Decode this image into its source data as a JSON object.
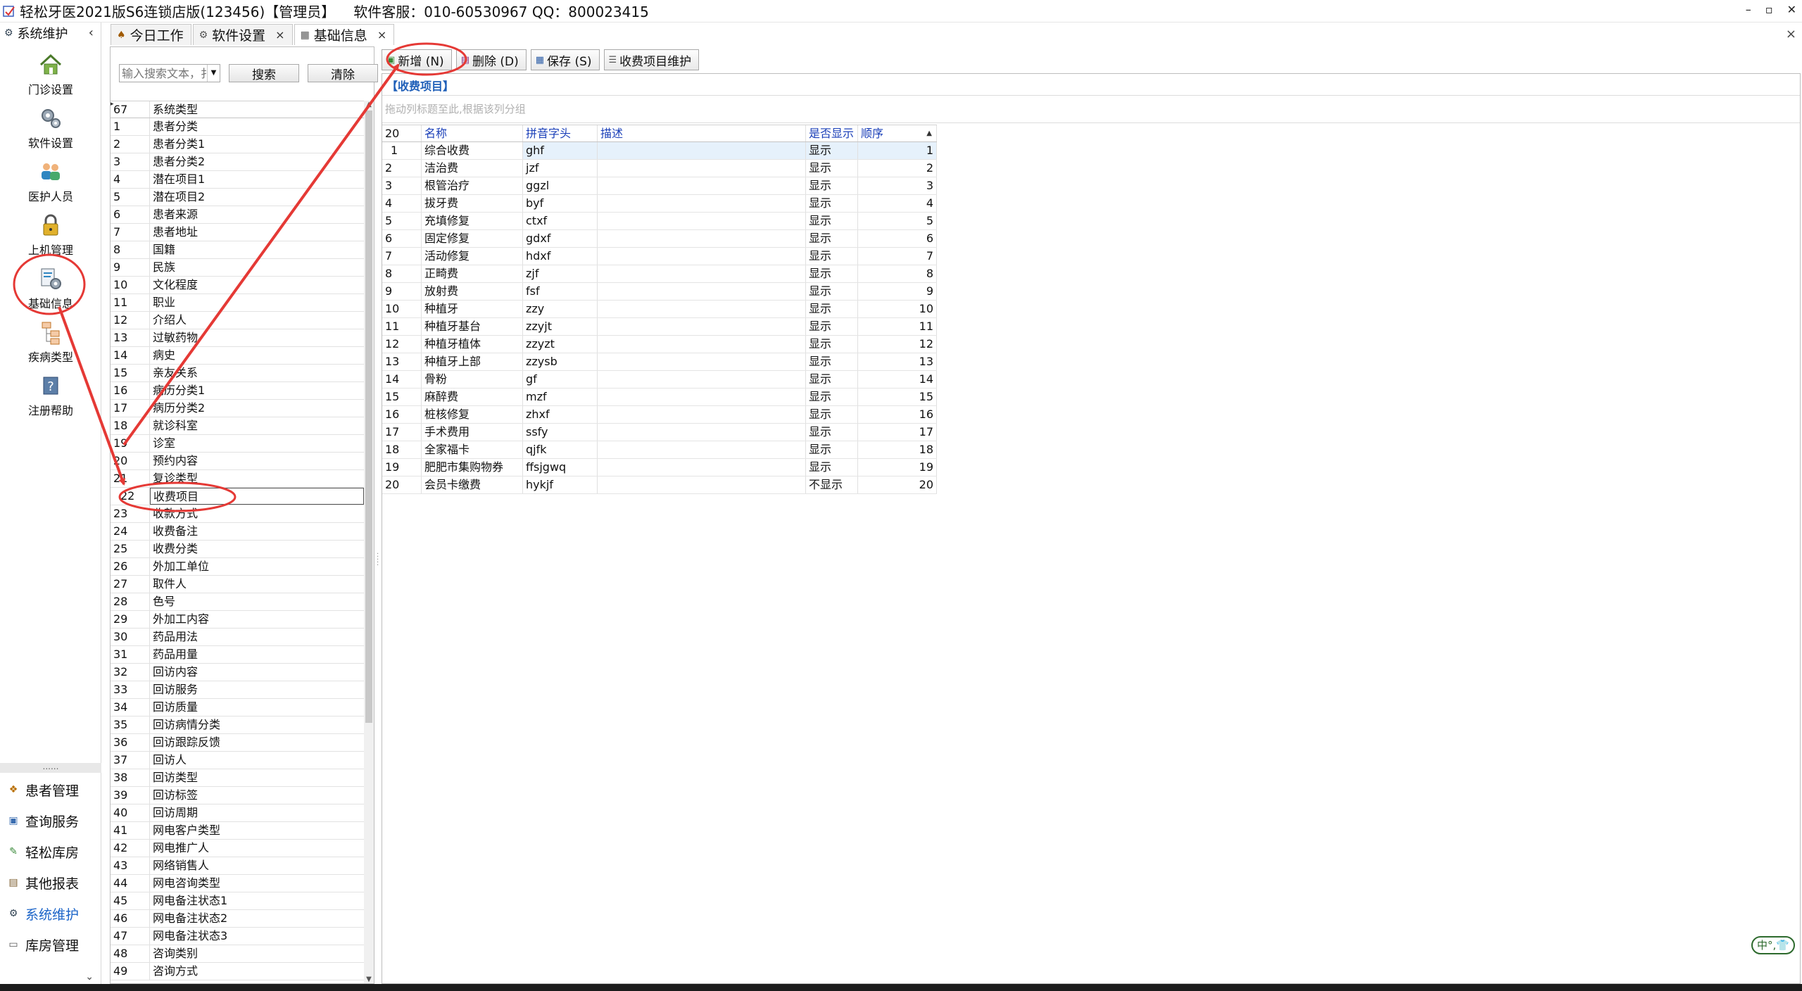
{
  "window": {
    "title": "轻松牙医2021版S6连锁店版(123456)【管理员】",
    "support": "软件客服：010-60530967 QQ：800023415",
    "buttons": [
      "–",
      "▫",
      "✕"
    ]
  },
  "sidebar": {
    "header": "系统维护",
    "collapse": "‹",
    "items": [
      {
        "label": "门诊设置",
        "icon": "house-icon"
      },
      {
        "label": "软件设置",
        "icon": "gears-icon"
      },
      {
        "label": "医护人员",
        "icon": "staff-icon"
      },
      {
        "label": "上机管理",
        "icon": "lock-icon"
      },
      {
        "label": "基础信息",
        "icon": "info-gear-icon"
      },
      {
        "label": "疾病类型",
        "icon": "tree-icon"
      },
      {
        "label": "注册帮助",
        "icon": "help-icon"
      }
    ],
    "dots": "......",
    "nav": [
      {
        "label": "患者管理"
      },
      {
        "label": "查询服务"
      },
      {
        "label": "轻松库房"
      },
      {
        "label": "其他报表"
      },
      {
        "label": "系统维护"
      },
      {
        "label": "库房管理"
      }
    ],
    "more": "⌄"
  },
  "tabs": [
    {
      "label": "今日工作",
      "closable": false
    },
    {
      "label": "软件设置",
      "closable": true
    },
    {
      "label": "基础信息",
      "closable": true
    }
  ],
  "tab_close_all": "×",
  "left_panel": {
    "search_placeholder": "输入搜索文本，扌",
    "search_button": "搜索",
    "clear_button": "清除",
    "count": "67",
    "column": "系统类型",
    "rows": [
      [
        "1",
        "患者分类"
      ],
      [
        "2",
        "患者分类1"
      ],
      [
        "3",
        "患者分类2"
      ],
      [
        "4",
        "潜在项目1"
      ],
      [
        "5",
        "潜在项目2"
      ],
      [
        "6",
        "患者来源"
      ],
      [
        "7",
        "患者地址"
      ],
      [
        "8",
        "国籍"
      ],
      [
        "9",
        "民族"
      ],
      [
        "10",
        "文化程度"
      ],
      [
        "11",
        "职业"
      ],
      [
        "12",
        "介绍人"
      ],
      [
        "13",
        "过敏药物"
      ],
      [
        "14",
        "病史"
      ],
      [
        "15",
        "亲友关系"
      ],
      [
        "16",
        "病历分类1"
      ],
      [
        "17",
        "病历分类2"
      ],
      [
        "18",
        "就诊科室"
      ],
      [
        "19",
        "诊室"
      ],
      [
        "20",
        "预约内容"
      ],
      [
        "21",
        "复诊类型"
      ],
      [
        "22",
        "收费项目"
      ],
      [
        "23",
        "收款方式"
      ],
      [
        "24",
        "收费备注"
      ],
      [
        "25",
        "收费分类"
      ],
      [
        "26",
        "外加工单位"
      ],
      [
        "27",
        "取件人"
      ],
      [
        "28",
        "色号"
      ],
      [
        "29",
        "外加工内容"
      ],
      [
        "30",
        "药品用法"
      ],
      [
        "31",
        "药品用量"
      ],
      [
        "32",
        "回访内容"
      ],
      [
        "33",
        "回访服务"
      ],
      [
        "34",
        "回访质量"
      ],
      [
        "35",
        "回访病情分类"
      ],
      [
        "36",
        "回访跟踪反馈"
      ],
      [
        "37",
        "回访人"
      ],
      [
        "38",
        "回访类型"
      ],
      [
        "39",
        "回访标签"
      ],
      [
        "40",
        "回访周期"
      ],
      [
        "41",
        "网电客户类型"
      ],
      [
        "42",
        "网电推广人"
      ],
      [
        "43",
        "网络销售人"
      ],
      [
        "44",
        "网电咨询类型"
      ],
      [
        "45",
        "网电备注状态1"
      ],
      [
        "46",
        "网电备注状态2"
      ],
      [
        "47",
        "网电备注状态3"
      ],
      [
        "48",
        "咨询类别"
      ],
      [
        "49",
        "咨询方式"
      ]
    ],
    "selected_index": 21
  },
  "toolbar": [
    {
      "label": "新增 (N)",
      "icon": "add-icon"
    },
    {
      "label": "删除 (D)",
      "icon": "delete-icon"
    },
    {
      "label": "保存 (S)",
      "icon": "save-icon"
    },
    {
      "label": "收费项目维护",
      "icon": "list-icon"
    }
  ],
  "right_panel": {
    "title": "【收费项目】",
    "group_hint": "拖动列标题至此,根据该列分组",
    "headers": {
      "count": "20",
      "name": "名称",
      "pinyin": "拼音字头",
      "desc": "描述",
      "show": "是否显示",
      "order": "顺序"
    },
    "rows": [
      [
        "1",
        "综合收费",
        "ghf",
        "",
        "显示",
        "1"
      ],
      [
        "2",
        "洁治费",
        "jzf",
        "",
        "显示",
        "2"
      ],
      [
        "3",
        "根管治疗",
        "ggzl",
        "",
        "显示",
        "3"
      ],
      [
        "4",
        "拔牙费",
        "byf",
        "",
        "显示",
        "4"
      ],
      [
        "5",
        "充填修复",
        "ctxf",
        "",
        "显示",
        "5"
      ],
      [
        "6",
        "固定修复",
        "gdxf",
        "",
        "显示",
        "6"
      ],
      [
        "7",
        "活动修复",
        "hdxf",
        "",
        "显示",
        "7"
      ],
      [
        "8",
        "正畸费",
        "zjf",
        "",
        "显示",
        "8"
      ],
      [
        "9",
        "放射费",
        "fsf",
        "",
        "显示",
        "9"
      ],
      [
        "10",
        "种植牙",
        "zzy",
        "",
        "显示",
        "10"
      ],
      [
        "11",
        "种植牙基台",
        "zzyjt",
        "",
        "显示",
        "11"
      ],
      [
        "12",
        "种植牙植体",
        "zzyzt",
        "",
        "显示",
        "12"
      ],
      [
        "13",
        "种植牙上部",
        "zzysb",
        "",
        "显示",
        "13"
      ],
      [
        "14",
        "骨粉",
        "gf",
        "",
        "显示",
        "14"
      ],
      [
        "15",
        "麻醉费",
        "mzf",
        "",
        "显示",
        "15"
      ],
      [
        "16",
        "桩核修复",
        "zhxf",
        "",
        "显示",
        "16"
      ],
      [
        "17",
        "手术费用",
        "ssfy",
        "",
        "显示",
        "17"
      ],
      [
        "18",
        "全家福卡",
        "qjfk",
        "",
        "显示",
        "18"
      ],
      [
        "19",
        "肥肥市集购物券",
        "ffsjgwq",
        "",
        "显示",
        "19"
      ],
      [
        "20",
        "会员卡缴费",
        "hykjf",
        "",
        "不显示",
        "20"
      ]
    ]
  },
  "ime": "中°,👕",
  "colors": {
    "accent": "#1a63c8",
    "annotation": "#e53935"
  }
}
